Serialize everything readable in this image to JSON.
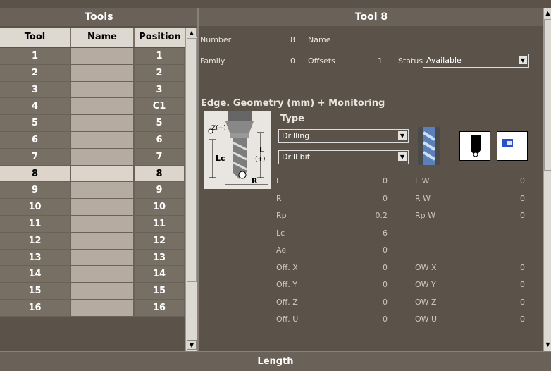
{
  "left_panel": {
    "title": "Tools",
    "columns": [
      "Tool",
      "Name",
      "Position"
    ],
    "rows": [
      {
        "tool": "1",
        "name": "",
        "position": "1"
      },
      {
        "tool": "2",
        "name": "",
        "position": "2"
      },
      {
        "tool": "3",
        "name": "",
        "position": "3"
      },
      {
        "tool": "4",
        "name": "",
        "position": "C1"
      },
      {
        "tool": "5",
        "name": "",
        "position": "5"
      },
      {
        "tool": "6",
        "name": "",
        "position": "6"
      },
      {
        "tool": "7",
        "name": "",
        "position": "7"
      },
      {
        "tool": "8",
        "name": "",
        "position": "8"
      },
      {
        "tool": "9",
        "name": "",
        "position": "9"
      },
      {
        "tool": "10",
        "name": "",
        "position": "10"
      },
      {
        "tool": "11",
        "name": "",
        "position": "11"
      },
      {
        "tool": "12",
        "name": "",
        "position": "12"
      },
      {
        "tool": "13",
        "name": "",
        "position": "13"
      },
      {
        "tool": "14",
        "name": "",
        "position": "14"
      },
      {
        "tool": "15",
        "name": "",
        "position": "15"
      },
      {
        "tool": "16",
        "name": "",
        "position": "16"
      }
    ],
    "selected_tool": "8"
  },
  "right_panel": {
    "title": "Tool 8",
    "number_label": "Number",
    "number_value": "8",
    "name_label": "Name",
    "name_value": "",
    "family_label": "Family",
    "family_value": "0",
    "offsets_label": "Offsets",
    "offsets_value": "1",
    "status_label": "Status",
    "status_value": "Available",
    "section_title": "Edge. Geometry (mm) + Monitoring",
    "type_label": "Type",
    "type_value": "Drilling",
    "subtype_value": "Drill bit",
    "diagram_labels": {
      "z": "Z(+)",
      "lc": "Lc",
      "l": "L",
      "l_plus": "(+)",
      "r": "R"
    },
    "params_left": [
      {
        "label": "L",
        "value": "0"
      },
      {
        "label": "R",
        "value": "0"
      },
      {
        "label": "Rp",
        "value": "0.2"
      },
      {
        "label": "Lc",
        "value": "6"
      },
      {
        "label": "Ae",
        "value": "0"
      },
      {
        "label": "Off. X",
        "value": "0"
      },
      {
        "label": "Off. Y",
        "value": "0"
      },
      {
        "label": "Off. Z",
        "value": "0"
      },
      {
        "label": "Off. U",
        "value": "0"
      }
    ],
    "params_right": [
      {
        "label": "L W",
        "value": "0"
      },
      {
        "label": "R W",
        "value": "0"
      },
      {
        "label": "Rp W",
        "value": "0"
      },
      {
        "label": "",
        "value": ""
      },
      {
        "label": "",
        "value": ""
      },
      {
        "label": "OW X",
        "value": "0"
      },
      {
        "label": "OW Y",
        "value": "0"
      },
      {
        "label": "OW Z",
        "value": "0"
      },
      {
        "label": "OW U",
        "value": "0"
      }
    ]
  },
  "footer": {
    "title": "Length"
  },
  "colors": {
    "background": "#5b5349",
    "header": "#6a6158",
    "selected_row": "#ddd5cc",
    "name_column": "#b5aba0",
    "accent_blue": "#2a4fc8"
  }
}
